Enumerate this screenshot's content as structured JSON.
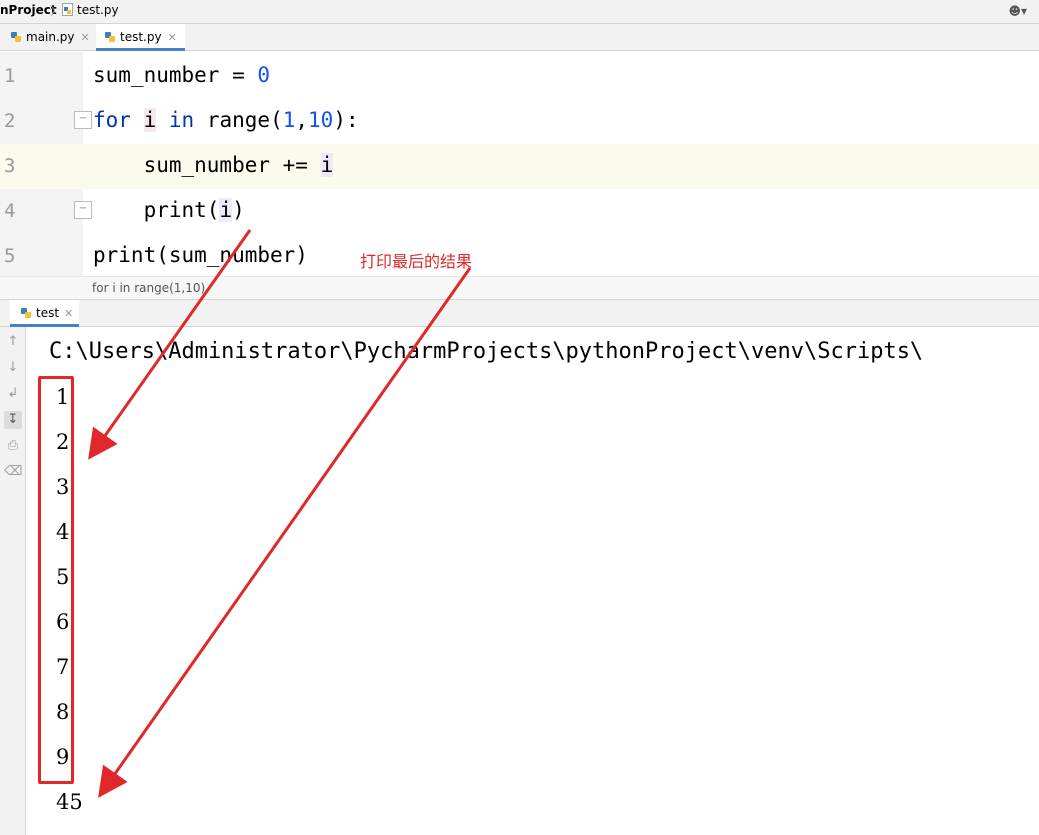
{
  "navbar": {
    "project": "nProject",
    "file": "test.py",
    "user_icon": "user-icon"
  },
  "tabs": [
    {
      "label": "main.py",
      "close": "✕",
      "active": false
    },
    {
      "label": "test.py",
      "close": "✕",
      "active": true
    }
  ],
  "editor": {
    "lines": [
      {
        "num": "1"
      },
      {
        "num": "2"
      },
      {
        "num": "3"
      },
      {
        "num": "4"
      },
      {
        "num": "5"
      }
    ],
    "tokens": {
      "l1_a": "sum_number = ",
      "l1_b": "0",
      "l2_for": "for",
      "l2_i": "i",
      "l2_in": "in",
      "l2_range": "range(",
      "l2_n1": "1",
      "l2_comma": ",",
      "l2_n2": "10",
      "l2_end": "):",
      "l3_a": "    sum_number += ",
      "l3_i": "i",
      "l4_a": "    print(",
      "l4_i": "i",
      "l4_b": ")",
      "l5": "print(sum_number)"
    },
    "annotation": "打印最后的结果",
    "breadcrumb": "for i in range(1,10)"
  },
  "run": {
    "tab_label": "test",
    "tab_close": "✕",
    "path": "C:\\Users\\Administrator\\PycharmProjects\\pythonProject\\venv\\Scripts\\",
    "output": [
      "1",
      "2",
      "3",
      "4",
      "5",
      "6",
      "7",
      "8",
      "9",
      "45"
    ],
    "tools": [
      "arrow-up-icon",
      "arrow-down-icon",
      "soft-wrap-icon",
      "scroll-to-end-icon",
      "print-icon",
      "trash-icon"
    ]
  },
  "colors": {
    "keyword": "#0033b3",
    "number": "#1750eb",
    "annotation_red": "#e0282a",
    "tab_accent": "#4083c9"
  }
}
